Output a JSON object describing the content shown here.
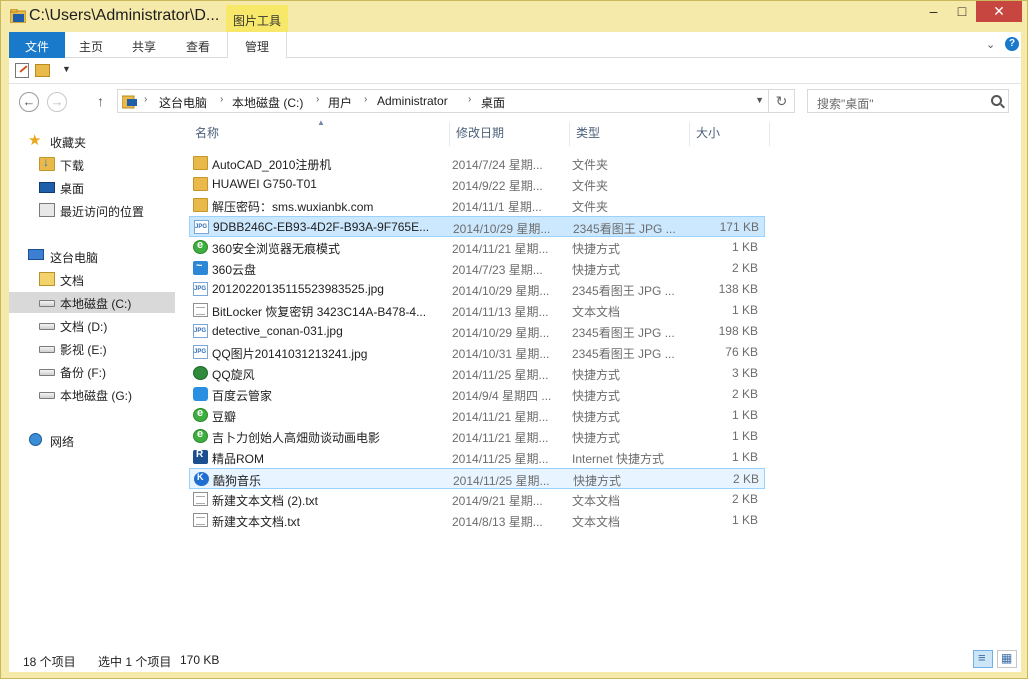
{
  "window": {
    "title": "C:\\Users\\Administrator\\D...",
    "context_tab": "图片工具",
    "minimize": "–",
    "maximize": "□",
    "close": "✕"
  },
  "ribbon": {
    "tabs": [
      "文件",
      "主页",
      "共享",
      "查看",
      "管理"
    ],
    "expand": "⌄",
    "help": "?"
  },
  "address": {
    "back": "←",
    "forward": "→",
    "up": "↑",
    "crumbs": [
      "这台电脑",
      "本地磁盘 (C:)",
      "用户",
      "Administrator",
      "桌面"
    ],
    "refresh": "↻"
  },
  "search": {
    "placeholder": "搜索\"桌面\""
  },
  "nav": {
    "favorites": "收藏夹",
    "downloads": "下载",
    "desktop": "桌面",
    "recent": "最近访问的位置",
    "this_pc": "这台电脑",
    "documents": "文档",
    "drive_c": "本地磁盘 (C:)",
    "drive_d": "文档 (D:)",
    "drive_e": "影视 (E:)",
    "drive_f": "备份 (F:)",
    "drive_g": "本地磁盘 (G:)",
    "network": "网络"
  },
  "columns": {
    "name": "名称",
    "date": "修改日期",
    "type": "类型",
    "size": "大小"
  },
  "files": [
    {
      "name": "AutoCAD_2010注册机",
      "date": "2014/7/24 星期...",
      "type": "文件夹",
      "size": "",
      "icon": "folder"
    },
    {
      "name": "HUAWEI G750-T01",
      "date": "2014/9/22 星期...",
      "type": "文件夹",
      "size": "",
      "icon": "folder"
    },
    {
      "name": "解压密码：sms.wuxianbk.com",
      "date": "2014/11/1 星期...",
      "type": "文件夹",
      "size": "",
      "icon": "folder"
    },
    {
      "name": "9DBB246C-EB93-4D2F-B93A-9F765E...",
      "date": "2014/10/29 星期...",
      "type": "2345看图王 JPG ...",
      "size": "171 KB",
      "icon": "jpg"
    },
    {
      "name": "360安全浏览器无痕模式",
      "date": "2014/11/21 星期...",
      "type": "快捷方式",
      "size": "1 KB",
      "icon": "ie"
    },
    {
      "name": "360云盘",
      "date": "2014/7/23 星期...",
      "type": "快捷方式",
      "size": "2 KB",
      "icon": "cloud"
    },
    {
      "name": "20120220135115523983525.jpg",
      "date": "2014/10/29 星期...",
      "type": "2345看图王 JPG ...",
      "size": "138 KB",
      "icon": "jpg"
    },
    {
      "name": "BitLocker 恢复密钥 3423C14A-B478-4...",
      "date": "2014/11/13 星期...",
      "type": "文本文档",
      "size": "1 KB",
      "icon": "txt"
    },
    {
      "name": "detective_conan-031.jpg",
      "date": "2014/10/29 星期...",
      "type": "2345看图王 JPG ...",
      "size": "198 KB",
      "icon": "jpg"
    },
    {
      "name": "QQ图片20141031213241.jpg",
      "date": "2014/10/31 星期...",
      "type": "2345看图王 JPG ...",
      "size": "76 KB",
      "icon": "jpg"
    },
    {
      "name": "QQ旋风",
      "date": "2014/11/25 星期...",
      "type": "快捷方式",
      "size": "3 KB",
      "icon": "qq"
    },
    {
      "name": "百度云管家",
      "date": "2014/9/4 星期四 ...",
      "type": "快捷方式",
      "size": "2 KB",
      "icon": "baidu"
    },
    {
      "name": "豆瓣",
      "date": "2014/11/21 星期...",
      "type": "快捷方式",
      "size": "1 KB",
      "icon": "ie"
    },
    {
      "name": "吉卜力创始人高畑勋谈动画电影",
      "date": "2014/11/21 星期...",
      "type": "快捷方式",
      "size": "1 KB",
      "icon": "ie"
    },
    {
      "name": "精品ROM",
      "date": "2014/11/25 星期...",
      "type": "Internet 快捷方式",
      "size": "1 KB",
      "icon": "rom"
    },
    {
      "name": "酷狗音乐",
      "date": "2014/11/25 星期...",
      "type": "快捷方式",
      "size": "2 KB",
      "icon": "kugou"
    },
    {
      "name": "新建文本文档 (2).txt",
      "date": "2014/9/21 星期...",
      "type": "文本文档",
      "size": "2 KB",
      "icon": "txt"
    },
    {
      "name": "新建文本文档.txt",
      "date": "2014/8/13 星期...",
      "type": "文本文档",
      "size": "1 KB",
      "icon": "txt"
    }
  ],
  "status": {
    "count": "18 个项目",
    "selection": "选中 1 个项目",
    "size": "170 KB"
  }
}
